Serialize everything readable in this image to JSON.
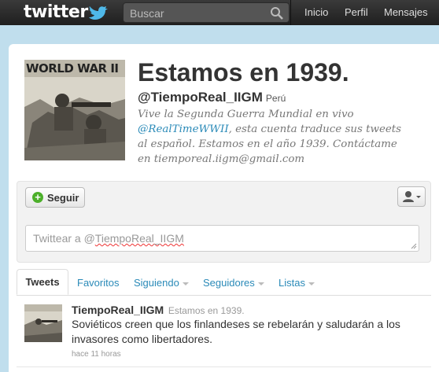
{
  "topbar": {
    "logo_text": "twitter",
    "search_placeholder": "Buscar",
    "nav": [
      "Inicio",
      "Perfil",
      "Mensajes"
    ]
  },
  "profile": {
    "image_caption": "WORLD WAR II",
    "name": "Estamos en 1939.",
    "handle": "@TiempoReal_IIGM",
    "location": "Perú",
    "bio_part1": "Vive la Segunda Guerra Mundial en vivo",
    "bio_link": "@RealTimeWWII",
    "bio_part2": ", esta cuenta traduce sus tweets al español. Estamos en el año 1939. Contáctame en tiemporeal.iigm@gmail.com"
  },
  "actions": {
    "follow_label": "Seguir",
    "tweetbox_prefix": "Twittear a @",
    "tweetbox_handle": "TiempoReal_IIGM"
  },
  "tabs": [
    "Tweets",
    "Favoritos",
    "Siguiendo",
    "Seguidores",
    "Listas"
  ],
  "tweet": {
    "name": "TiempoReal_IIGM",
    "subname": "Estamos en 1939.",
    "text": "Soviéticos creen que los finlandeses se rebelarán y saludarán a los invasores como libertadores.",
    "time": "hace 11 horas"
  },
  "colors": {
    "background": "#c0deed",
    "link": "#2a8ab8",
    "follow_icon": "#4caf2a"
  }
}
